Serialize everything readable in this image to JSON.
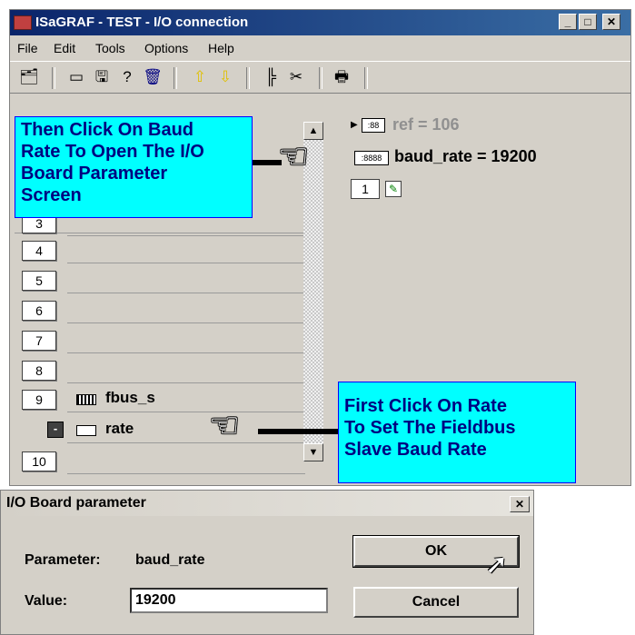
{
  "window": {
    "title": "ISaGRAF - TEST - I/O connection",
    "controls": {
      "minimize": "_",
      "maximize": "□",
      "close": "✕"
    }
  },
  "menu": [
    "File",
    "Edit",
    "Tools",
    "Options",
    "Help"
  ],
  "toolbar": {
    "icons": [
      "open-icon",
      "board-icon",
      "new-board-icon",
      "help-icon",
      "delete-icon",
      "arrow-up-icon",
      "arrow-down-icon",
      "tree-icon",
      "cut-icon",
      "print-icon"
    ],
    "glyphs": [
      "🗂",
      "▭",
      "🖫",
      "?",
      "🗑",
      "⇧",
      "⇩",
      "╠",
      "✂",
      "🖶"
    ]
  },
  "rows": [
    {
      "num": "3",
      "label": "",
      "icon": false
    },
    {
      "num": "4",
      "label": "",
      "icon": false
    },
    {
      "num": "5",
      "label": "",
      "icon": false
    },
    {
      "num": "6",
      "label": "",
      "icon": false
    },
    {
      "num": "7",
      "label": "",
      "icon": false
    },
    {
      "num": "8",
      "label": "",
      "icon": false
    },
    {
      "num": "9",
      "label": "fbus_s",
      "icon": true
    },
    {
      "num": "",
      "label": "rate",
      "icon": true,
      "minus": "-"
    },
    {
      "num": "10",
      "label": "",
      "icon": false
    }
  ],
  "right_pane": {
    "ref_line": "ref = 106",
    "baud_line": "baud_rate = 19200",
    "index": "1"
  },
  "callouts": {
    "top": [
      "Then Click On Baud",
      "Rate To Open The I/O",
      "Board Parameter",
      "Screen"
    ],
    "bottom": [
      "First Click On Rate",
      "To Set The Fieldbus",
      "Slave Baud Rate"
    ]
  },
  "dialog": {
    "title": "I/O Board parameter",
    "close": "✕",
    "parameter_label": "Parameter:",
    "parameter_value": "baud_rate",
    "value_label": "Value:",
    "value": "19200",
    "ok": "OK",
    "cancel": "Cancel"
  },
  "colors": {
    "callout_bg": "#00ffff",
    "callout_text": "#000080",
    "title_bar": "#0a246a"
  }
}
